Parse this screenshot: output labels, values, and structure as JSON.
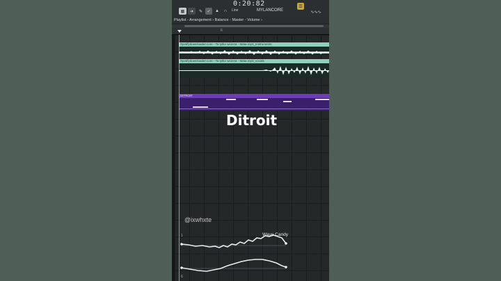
{
  "toolbar": {
    "time_display": "0:20:82",
    "mode_label": "Line",
    "project_name": "MYLANCORE"
  },
  "breadcrumb": {
    "path": "Playlist - Arrangement › Balance - Master - Volume ›"
  },
  "ruler": {
    "mark": "6"
  },
  "tracks": {
    "instrumental_clip_label": "Spotifydownloader.com - Ta tytko wionna - Mata.mp3_Instruments",
    "vocals_clip_label": "Spotifydownloader.com - Ta tytko wionna - Mata.mp3_vocals",
    "pattern_clip_label": "DITROIT"
  },
  "overlay": {
    "title": "Ditroit",
    "watermark": "@ixwhxte",
    "wave_label": "Wave Candy"
  },
  "colors": {
    "audio_clip": "#8fd0bb",
    "pattern_clip": "#6b3fb3",
    "background": "#4f5f58"
  }
}
